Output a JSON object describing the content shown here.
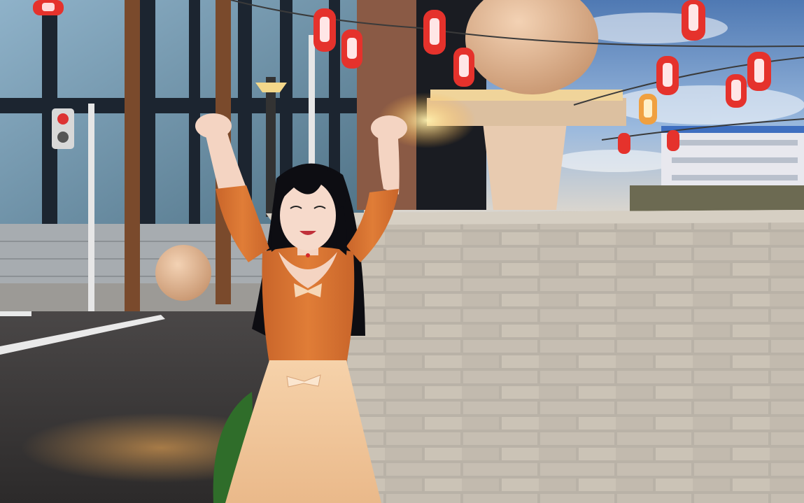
{
  "scene": {
    "name": "3d-game-city-street-scene",
    "ui_text": []
  },
  "character": {
    "pose": "arms-raised-cheering",
    "hair_color": "#0d0d12",
    "top_color": "#d9752f",
    "skirt_color": "#f3c79a",
    "skin_color": "#f4d4c2"
  },
  "environment": {
    "sky_color": "#7fa6d6",
    "wall_color": "#c9c2b6",
    "road_color": "#3d3b3b",
    "lantern_color": "#e5322c"
  }
}
